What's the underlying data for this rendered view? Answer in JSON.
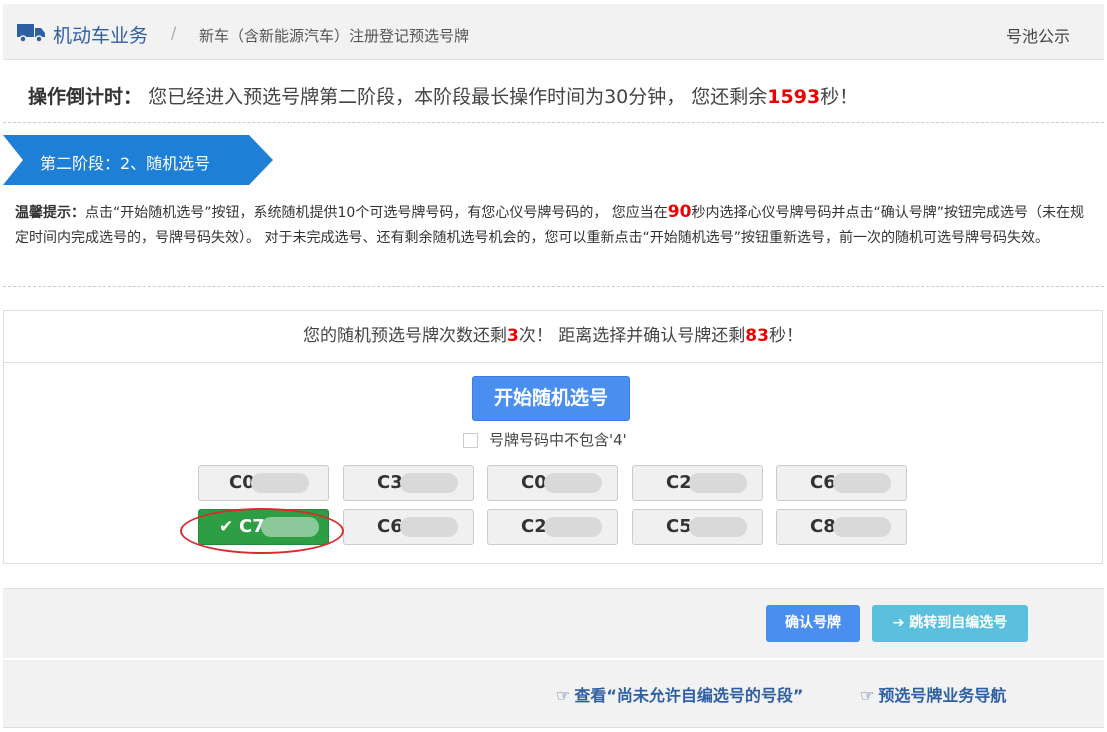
{
  "header": {
    "breadcrumb_main": "机动车业务",
    "breadcrumb_sep": "/",
    "breadcrumb_sub": "新车（含新能源汽车）注册登记预选号牌",
    "pool_link": "号池公示"
  },
  "countdown": {
    "label": "操作倒计时：",
    "text_before": "您已经进入预选号牌第二阶段，本阶段最长操作时间为30分钟， 您还剩余",
    "seconds": "1593",
    "text_after": "秒！"
  },
  "stage": {
    "label": "第二阶段：2、随机选号"
  },
  "tip": {
    "label": "温馨提示：",
    "part1": "点击“开始随机选号”按钮，系统随机提供10个可选号牌号码，有您心仪号牌号码的， 您应当在",
    "seconds": "90",
    "part2": "秒内选择心仪号牌号码并点击“确认号牌”按钮完成选号（未在规定时间内完成选号的，号牌号码失效）。 对于未完成选号、还有剩余随机选号机会的，您可以重新点击“开始随机选号”按钮重新选号，前一次的随机可选号牌号码失效。"
  },
  "panel": {
    "status_before": "您的随机预选号牌次数还剩",
    "remaining_count": "3",
    "status_mid": "次！ 距离选择并确认号牌还剩",
    "remaining_seconds": "83",
    "status_after": "秒！",
    "start_button": "开始随机选号",
    "checkbox_label": "号牌号码中不包含'4'",
    "plates": [
      "C0",
      "C3",
      "C0",
      "C2",
      "C6",
      "C7",
      "C6",
      "C2",
      "C5",
      "C8"
    ],
    "selected_index": 5
  },
  "actions": {
    "confirm_button": "确认号牌",
    "jump_button": "跳转到自编选号"
  },
  "nav": {
    "link1": "查看“尚未允许自编选号的号段”",
    "link2": "预选号牌业务导航"
  },
  "colors": {
    "accent": "#4a8ff0",
    "stage_blue": "#1e7fd6",
    "selected_green": "#2e9e45",
    "warning_red": "#e00000"
  }
}
